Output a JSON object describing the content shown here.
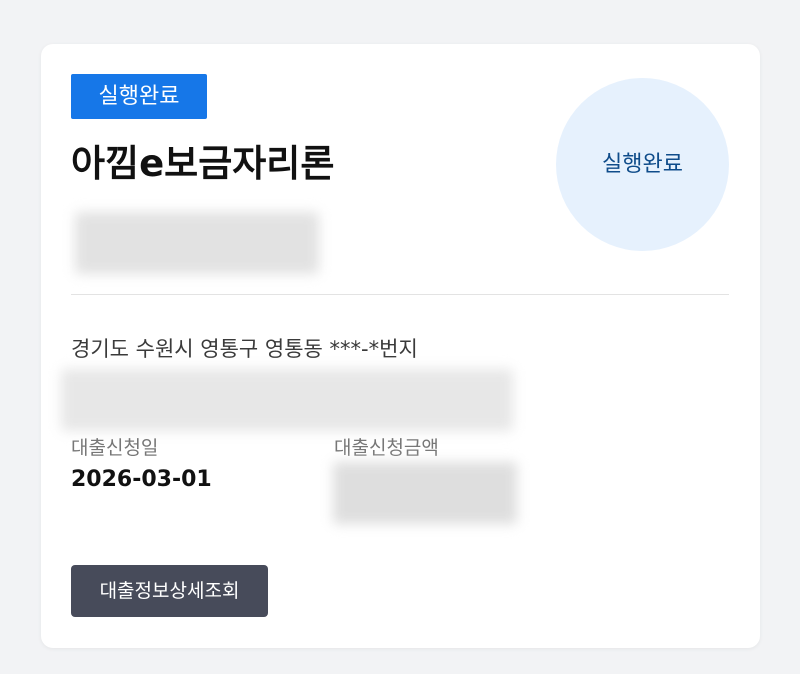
{
  "status_badge": "실행완료",
  "product_name": "아낌e보금자리론",
  "status_circle": "실행완료",
  "address": "경기도 수원시 영통구 영통동 ***-*번지",
  "fields": {
    "application_date_label": "대출신청일",
    "application_date_value": "2026-03-01",
    "application_amount_label": "대출신청금액"
  },
  "detail_button": "대출정보상세조회",
  "colors": {
    "accent": "#1677e8",
    "circle_bg": "#e6f1fd",
    "circle_text": "#0f4c8a",
    "button_bg": "#474b5a"
  }
}
